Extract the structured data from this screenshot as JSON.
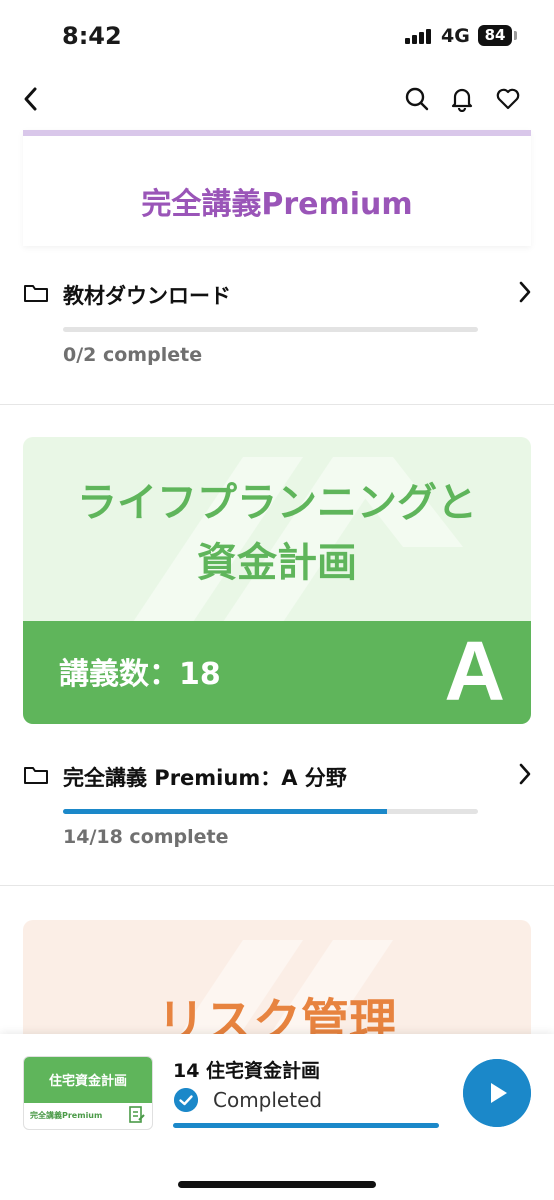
{
  "status_bar": {
    "time": "8:42",
    "network": "4G",
    "battery": "84"
  },
  "nav": {
    "back_icon": "chevron-left-icon",
    "search_icon": "search-icon",
    "bell_icon": "bell-icon",
    "heart_icon": "heart-icon"
  },
  "sections": [
    {
      "banner_text": "完全講義Premium",
      "folder_title": "教材ダウンロード",
      "progress_fraction": 0.0,
      "complete_text": "0/2 complete"
    },
    {
      "card_title_line1": "ライフプランニングと",
      "card_title_line2": "資金計画",
      "lecture_count": "講義数：18",
      "grade": "A",
      "folder_title": "完全講義 Premium：A 分野",
      "progress_fraction": 0.78,
      "complete_text": "14/18 complete"
    },
    {
      "card_title": "リスク管理"
    }
  ],
  "mini_player": {
    "thumb_title": "住宅資金計画",
    "thumb_sub": "完全講義Premium",
    "title": "14 住宅資金計画",
    "status": "Completed",
    "progress_fraction": 1.0
  },
  "colors": {
    "accent_blue": "#1b88c9",
    "green": "#5fb55b",
    "purple": "#9a55b8",
    "orange": "#e7833f"
  }
}
